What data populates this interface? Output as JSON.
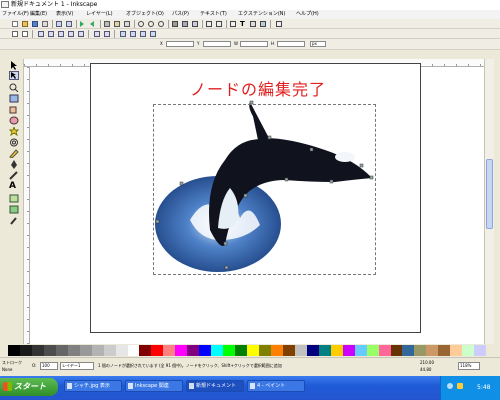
{
  "window": {
    "title": "新規ドキュメント 1 - Inkscape"
  },
  "menu": [
    "ファイル(F)",
    "編集(E)",
    "表示(V)",
    "レイヤー(L)",
    "オブジェクト(O)",
    "パス(P)",
    "テキスト(T)",
    "エクステンション(N)",
    "ヘルプ(H)"
  ],
  "controls": {
    "x_label": "X",
    "y_label": "Y",
    "w_label": "W",
    "h_label": "H",
    "x_value": "",
    "y_value": "",
    "w_value": "",
    "h_value": "",
    "unit": "px"
  },
  "canvas": {
    "heading": "ノードの編集完了"
  },
  "status": {
    "stroke_label": "ストローク",
    "stroke_value": "None",
    "opacity_label": "O:",
    "opacity_value": "100",
    "layer": "レイヤー1",
    "message": "1 個のノードが選択されています (全 91 個中)。ノードをクリック、Shift+クリックで選択範囲に追加",
    "x_coord": "210.00",
    "y_coord": "44.80",
    "zoom": "118%"
  },
  "palette": [
    "#000000",
    "#1a1a1a",
    "#333333",
    "#4d4d4d",
    "#666666",
    "#808080",
    "#999999",
    "#b3b3b3",
    "#cccccc",
    "#e6e6e6",
    "#ffffff",
    "#800000",
    "#ff0000",
    "#ff8080",
    "#ff00ff",
    "#800080",
    "#0000ff",
    "#00ffff",
    "#00ff00",
    "#008000",
    "#ffff00",
    "#808000",
    "#ff8000",
    "#804000",
    "#c0c0c0",
    "#000080",
    "#008080",
    "#ffcc00",
    "#cc00ff",
    "#66ccff",
    "#99ff66",
    "#ff6699",
    "#663300",
    "#336699",
    "#999966",
    "#cc9966",
    "#996633",
    "#ffcc99",
    "#ccffcc",
    "#ccccff"
  ],
  "taskbar": {
    "start": "スタート",
    "tasks": [
      "シャチ.jpg 表示",
      "Inkscape 関連",
      "新規ドキュメント",
      "4 - ペイント"
    ],
    "clock": "5:48"
  }
}
